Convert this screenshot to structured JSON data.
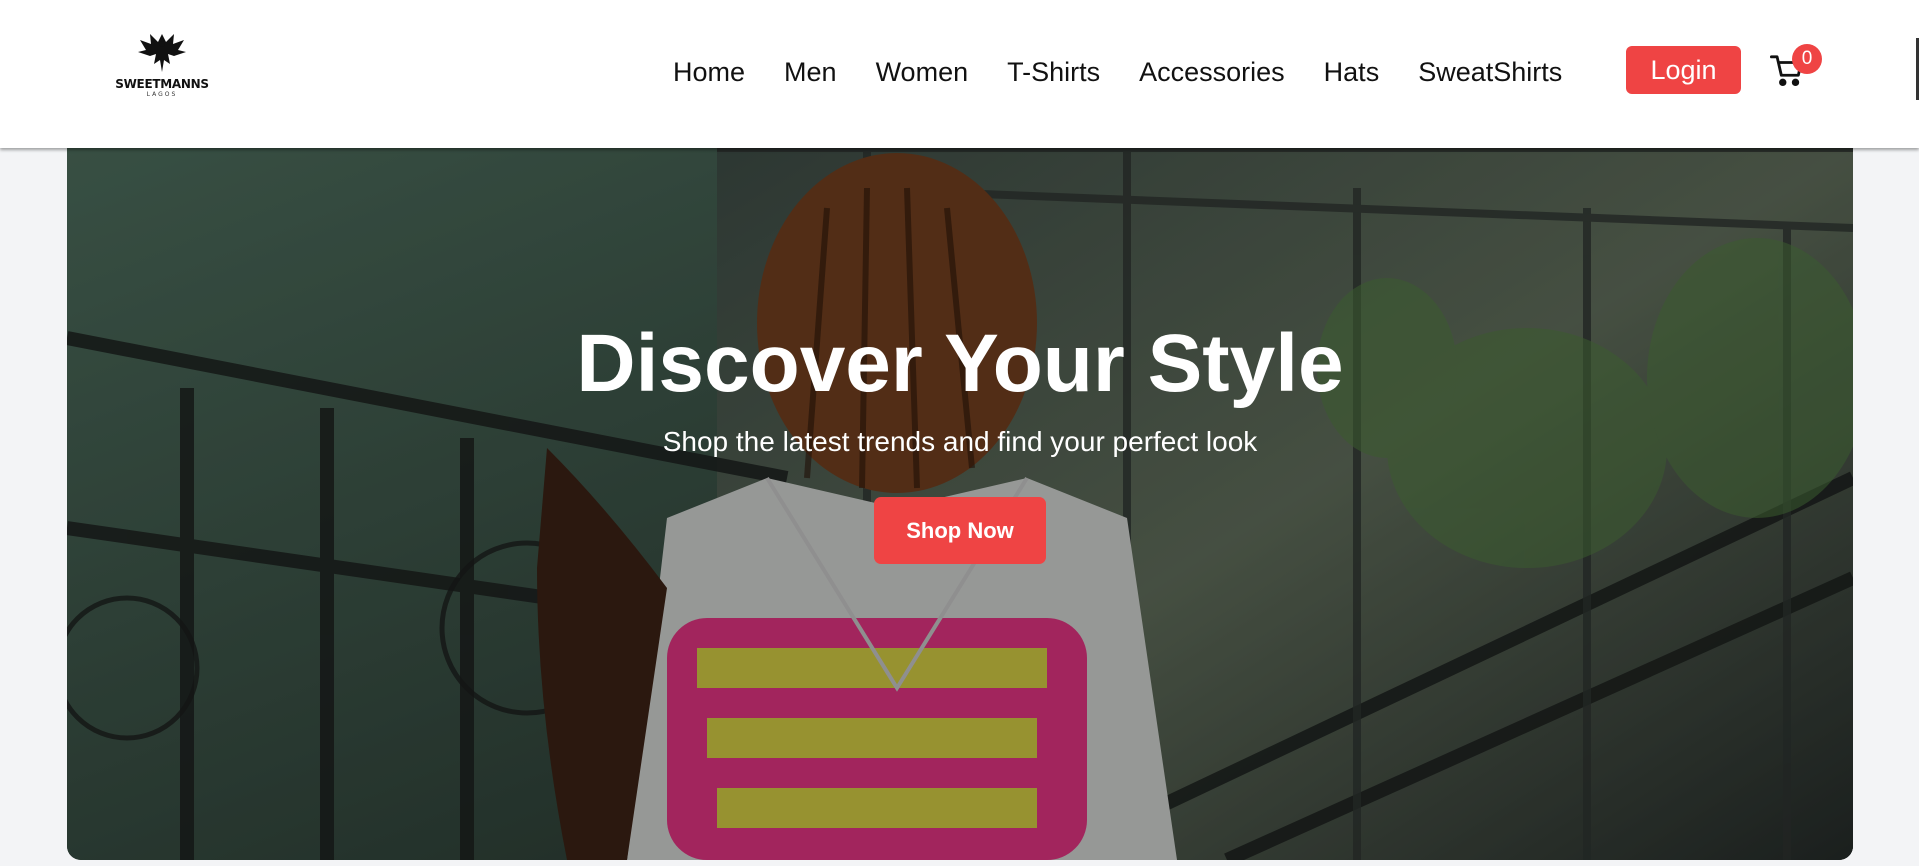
{
  "brand": {
    "name": "SWEETMANNS",
    "tagline": "LAGOS"
  },
  "nav": {
    "items": [
      "Home",
      "Men",
      "Women",
      "T-Shirts",
      "Accessories",
      "Hats",
      "SweatShirts"
    ]
  },
  "header": {
    "login_label": "Login",
    "cart_count": "0",
    "cart_icon": "cart-icon"
  },
  "hero": {
    "title": "Discover Your Style",
    "subtitle": "Shop the latest trends and find your perfect look",
    "cta_label": "Shop Now"
  },
  "colors": {
    "accent": "#ef4444",
    "header_bg": "#ffffff",
    "page_bg": "#f3f4f6"
  }
}
